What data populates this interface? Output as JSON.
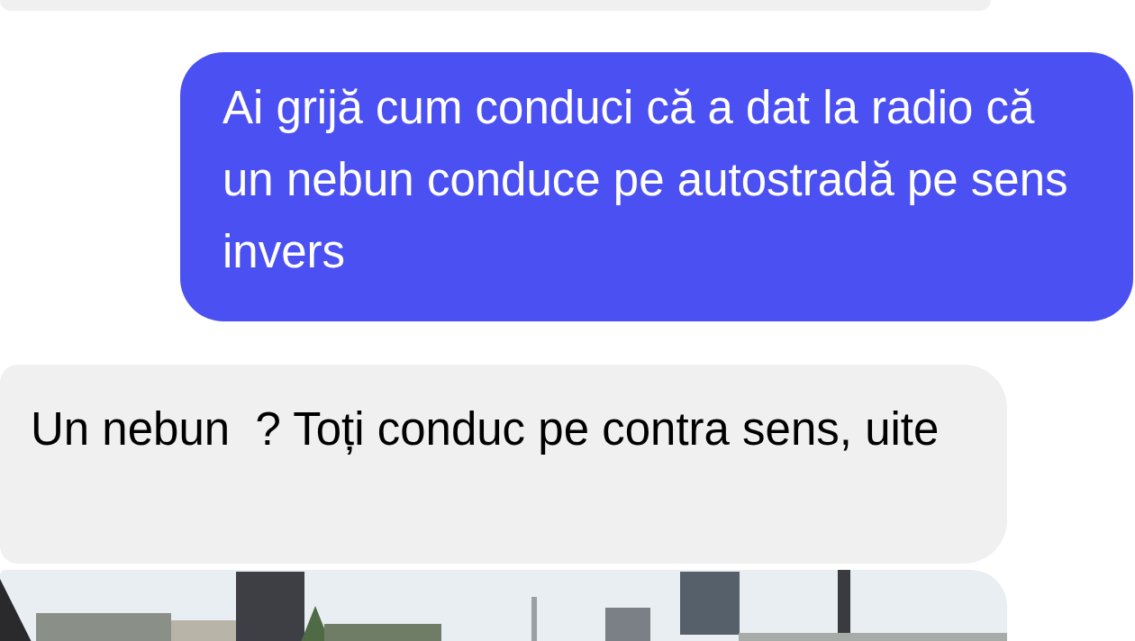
{
  "messages": [
    {
      "kind": "cut"
    },
    {
      "kind": "sent",
      "text": "Ai grijă cum conduci că a dat la radio că un nebun conduce pe autostradă pe sens invers"
    },
    {
      "kind": "received",
      "text": "Un nebun  ? Toți conduc pe contra sens, uite"
    },
    {
      "kind": "picture"
    }
  ]
}
